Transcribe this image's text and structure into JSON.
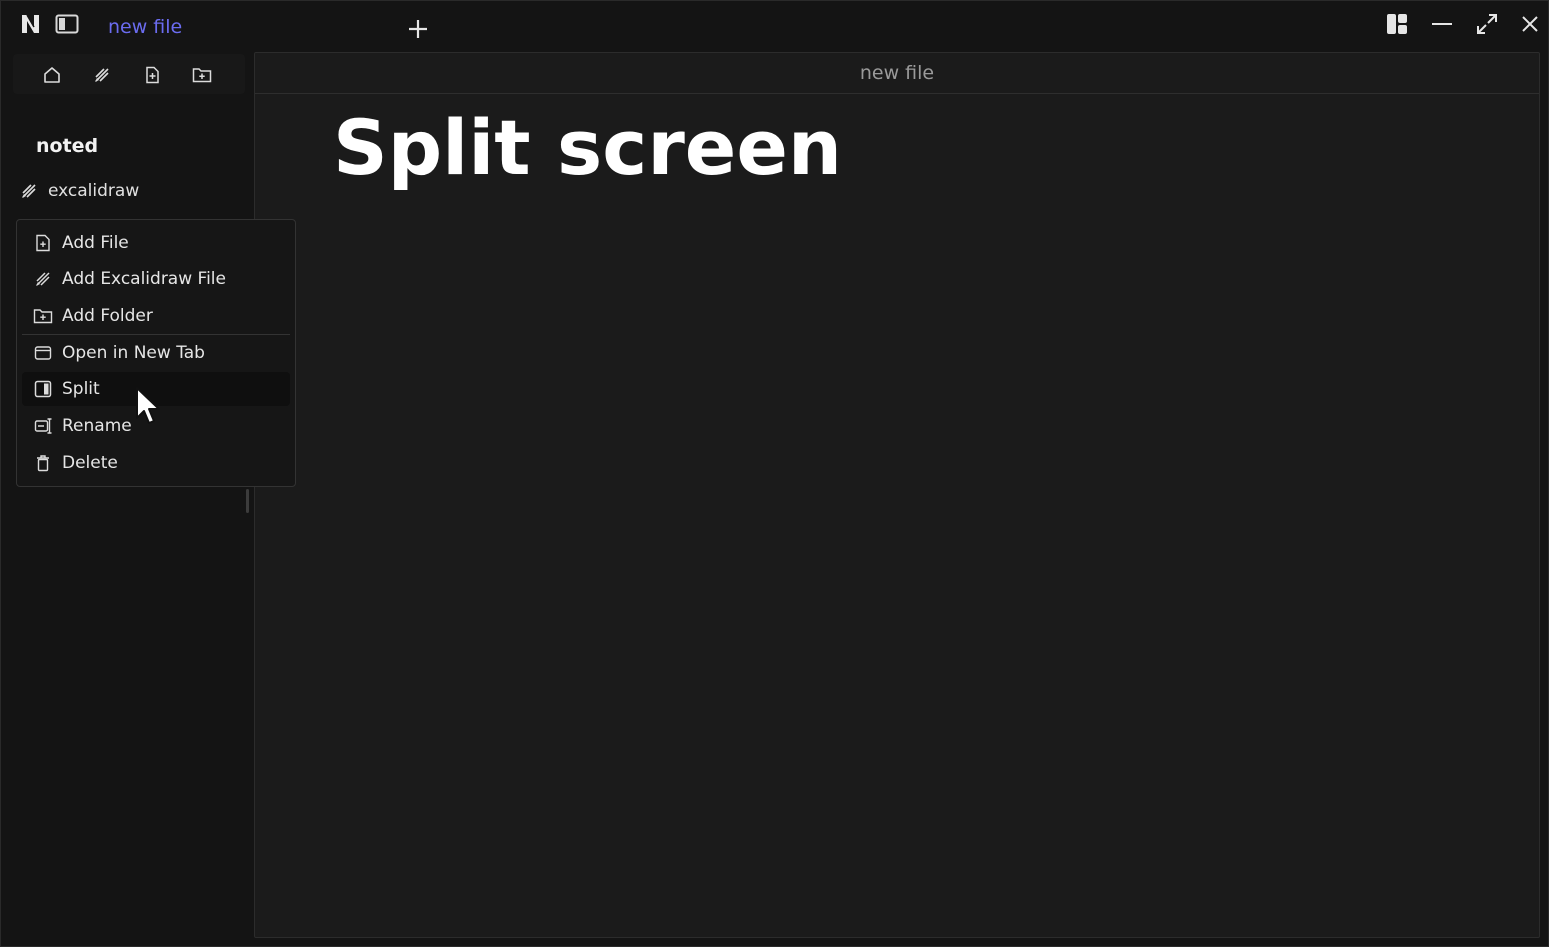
{
  "titlebar": {
    "logo_icon": "noted-logo-icon",
    "tab_title": "new file",
    "tab_title_color": "#6b6cf0"
  },
  "sidebar": {
    "toolbar": [
      "home-icon",
      "excalidraw-icon",
      "new-file-icon",
      "new-folder-icon"
    ],
    "vault_name": "noted",
    "tree": [
      {
        "label": "excalidraw",
        "icon": "excalidraw-icon"
      }
    ]
  },
  "editor": {
    "header_title": "new file",
    "heading": "Split screen"
  },
  "context_menu": {
    "items": [
      {
        "label": "Add File",
        "icon": "file-plus-icon"
      },
      {
        "label": "Add Excalidraw File",
        "icon": "excalidraw-icon"
      },
      {
        "label": "Add Folder",
        "icon": "folder-plus-icon"
      },
      {
        "label": "Open in New Tab",
        "icon": "tab-icon"
      },
      {
        "label": "Split",
        "icon": "split-icon",
        "hovered": true
      },
      {
        "label": "Rename",
        "icon": "rename-icon"
      },
      {
        "label": "Delete",
        "icon": "trash-icon"
      }
    ]
  }
}
